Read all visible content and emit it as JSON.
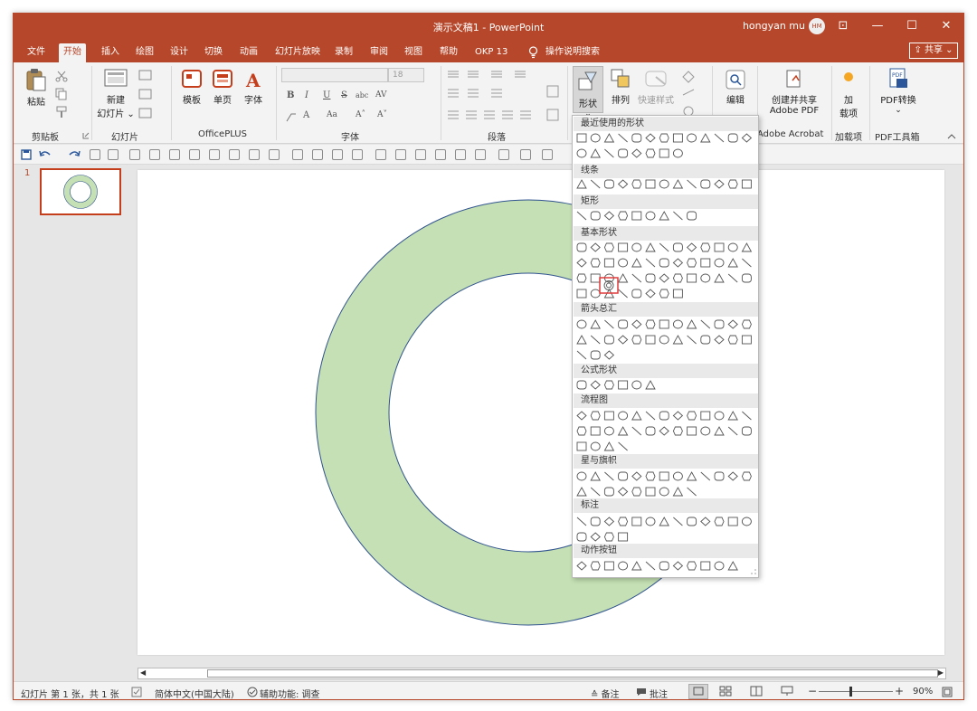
{
  "window": {
    "title": "演示文稿1 - PowerPoint",
    "user_name": "hongyan mu",
    "user_initials": "HM",
    "minimize": "—",
    "restore": "☐",
    "close": "✕",
    "ribbon_display": "⊡"
  },
  "tabs": [
    {
      "label": "文件"
    },
    {
      "label": "开始"
    },
    {
      "label": "插入"
    },
    {
      "label": "绘图"
    },
    {
      "label": "设计"
    },
    {
      "label": "切换"
    },
    {
      "label": "动画"
    },
    {
      "label": "幻灯片放映"
    },
    {
      "label": "录制"
    },
    {
      "label": "审阅"
    },
    {
      "label": "视图"
    },
    {
      "label": "帮助"
    },
    {
      "label": "OKP 13"
    },
    {
      "label": "操作说明搜索"
    }
  ],
  "share_label": "⇪ 共享 ⌄",
  "ribbon": {
    "clipboard": {
      "paste": "粘贴",
      "group": "剪贴板"
    },
    "slides": {
      "new_slide_1": "新建",
      "new_slide_2": "幻灯片 ⌄",
      "group": "幻灯片"
    },
    "officeplus": {
      "template": "模板",
      "single_page": "单页",
      "font": "字体",
      "group": "OfficePLUS"
    },
    "font": {
      "size": "18",
      "group": "字体",
      "bold": "B",
      "italic": "I",
      "underline": "U",
      "strike": "S",
      "abc": "abc",
      "av": "AV",
      "color_a": "A",
      "aa": "Aa",
      "grow": "A˄",
      "shrink": "A˅"
    },
    "paragraph": {
      "group": "段落"
    },
    "drawing": {
      "shape": "形状",
      "arrange": "排列",
      "quick_style": "快速样式"
    },
    "editing": {
      "label": "编辑"
    },
    "adobe": {
      "label_1": "创建并共享",
      "label_2": "Adobe PDF",
      "group": "Adobe Acrobat"
    },
    "addins": {
      "label_1": "加",
      "label_2": "载项",
      "group": "加载项"
    },
    "pdf": {
      "label": "PDF转换",
      "group": "PDF工具箱"
    }
  },
  "thumbnail": {
    "number": "1"
  },
  "shapes_gallery": {
    "sections": [
      {
        "title": "最近使用的形状"
      },
      {
        "title": "线条"
      },
      {
        "title": "矩形"
      },
      {
        "title": "基本形状"
      },
      {
        "title": "箭头总汇"
      },
      {
        "title": "公式形状"
      },
      {
        "title": "流程图"
      },
      {
        "title": "星与旗帜"
      },
      {
        "title": "标注"
      },
      {
        "title": "动作按钮"
      }
    ],
    "selected_shape": "donut"
  },
  "status": {
    "slide_info": "幻灯片 第 1 张，共 1 张",
    "language": "简体中文(中国大陆)",
    "accessibility": "辅助功能: 调查",
    "notes": "≙ 备注",
    "comments": "批注",
    "zoom": "90%",
    "zoom_minus": "−",
    "zoom_plus": "+"
  },
  "colors": {
    "accent": "#b7472a",
    "donut_fill": "#c5e0b4",
    "donut_stroke": "#2f528f"
  }
}
